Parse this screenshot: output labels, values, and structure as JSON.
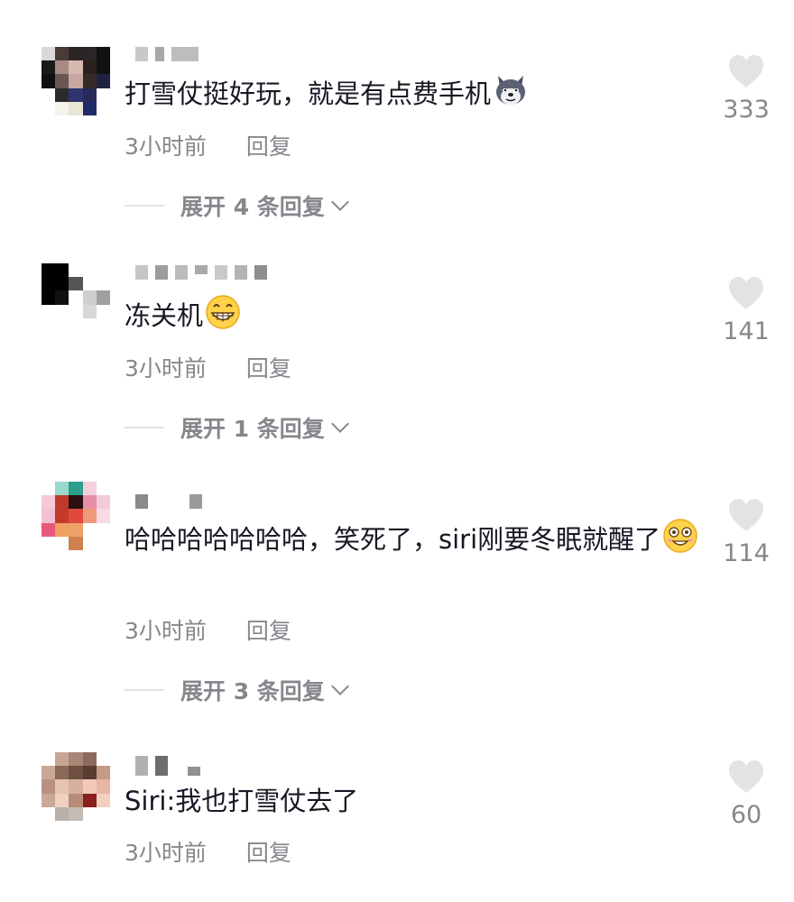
{
  "comments": [
    {
      "text": "打雪仗挺好玩，就是有点费手机",
      "emoji": "husky-emoji",
      "time": "3小时前",
      "reply_label": "回复",
      "expand_label": "展开 4 条回复",
      "likes": "333"
    },
    {
      "text": "冻关机",
      "emoji": "grin-emoji",
      "time": "3小时前",
      "reply_label": "回复",
      "expand_label": "展开 1 条回复",
      "likes": "141"
    },
    {
      "text": "哈哈哈哈哈哈哈，笑死了，siri刚要冬眠就醒了",
      "emoji": "silly-grin-emoji",
      "time": "3小时前",
      "reply_label": "回复",
      "expand_label": "展开 3 条回复",
      "likes": "114"
    },
    {
      "text": "Siri:我也打雪仗去了",
      "time": "3小时前",
      "reply_label": "回复",
      "likes": "60"
    }
  ],
  "colors": {
    "text_primary": "#161823",
    "text_secondary": "#86878c",
    "heart_icon": "#e3e3e5",
    "divider": "#e3e3e4"
  }
}
